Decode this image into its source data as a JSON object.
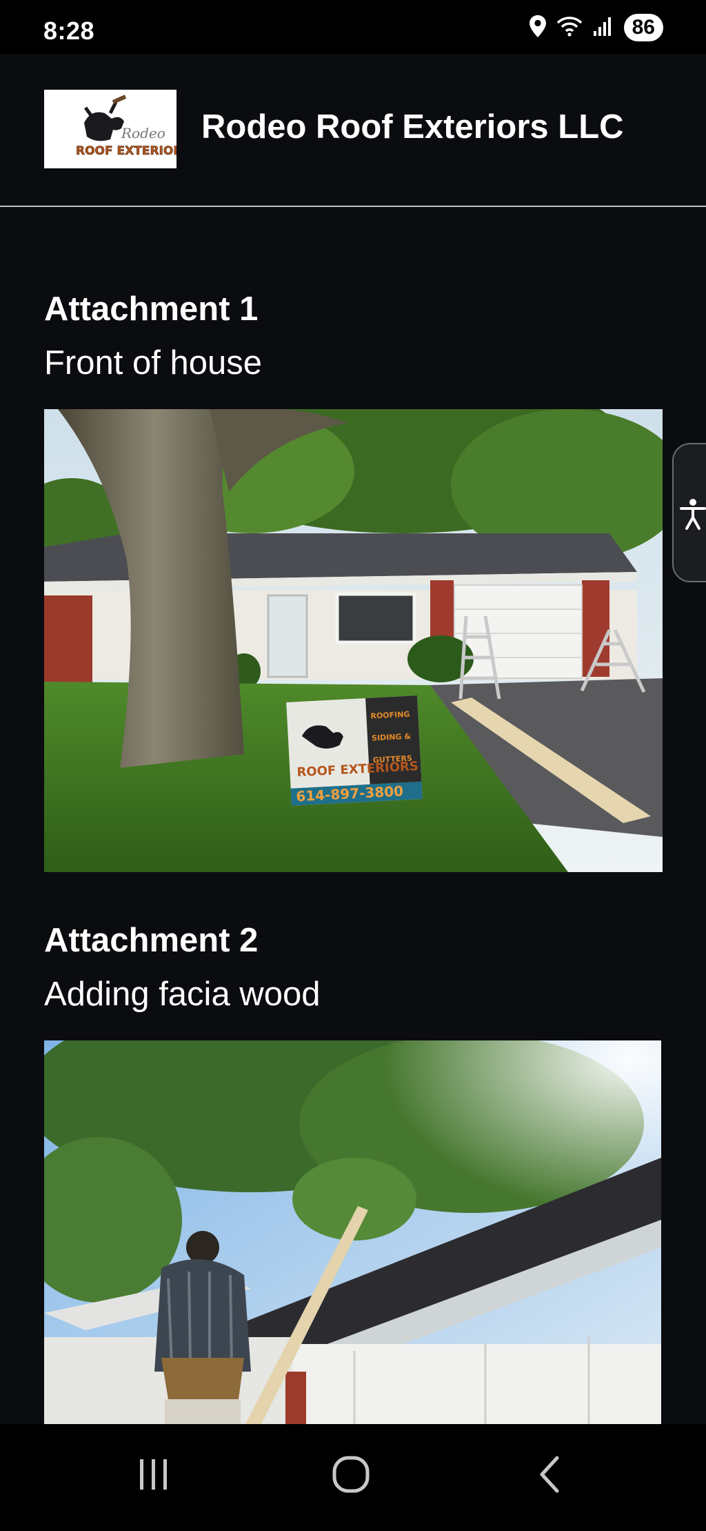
{
  "status_bar": {
    "time": "8:28",
    "battery": "86",
    "icons": [
      "location-icon",
      "wifi-icon",
      "signal-icon",
      "battery-icon"
    ]
  },
  "header": {
    "title": "Rodeo Roof Exteriors LLC",
    "logo": {
      "line1": "Rodeo",
      "line2": "ROOF EXTERIORS"
    }
  },
  "attachments": [
    {
      "heading": "Attachment 1",
      "caption": "Front of house",
      "sign": {
        "line1": "ROOFING",
        "line2": "SIDING &",
        "line3": "GUTTERS",
        "phone": "614-897-3800"
      }
    },
    {
      "heading": "Attachment 2",
      "caption": "Adding facia wood"
    }
  ],
  "accessibility": {
    "icon": "accessibility-icon"
  },
  "navbar": {
    "icons": [
      "recent-apps-icon",
      "home-icon",
      "back-icon"
    ]
  },
  "colors": {
    "background": "#0b0c0f",
    "text": "#ffffff",
    "divider": "#bfc3c8"
  }
}
